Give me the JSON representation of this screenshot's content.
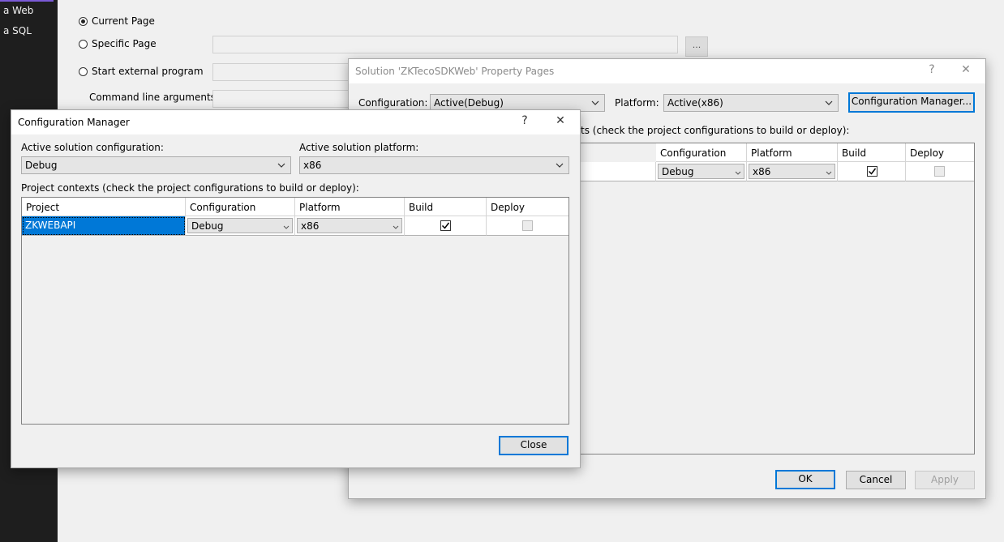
{
  "sidebar": {
    "items": [
      "a Web",
      "a SQL"
    ]
  },
  "background_page": {
    "radios": [
      {
        "label": "Current Page",
        "checked": true
      },
      {
        "label": "Specific Page",
        "checked": false
      },
      {
        "label": "Start external program",
        "checked": false
      }
    ],
    "command_line_label": "Command line arguments",
    "browse_label": "..."
  },
  "property_pages": {
    "title": "Solution 'ZKTecoSDKWeb' Property Pages",
    "help_glyph": "?",
    "close_glyph": "✕",
    "configuration_label": "Configuration:",
    "configuration_value": "Active(Debug)",
    "platform_label": "Platform:",
    "platform_value": "Active(x86)",
    "config_manager_button": "Configuration Manager...",
    "contexts_partial": "ts (check the project configurations to build or deploy):",
    "columns": [
      "Configuration",
      "Platform",
      "Build",
      "Deploy"
    ],
    "row": {
      "configuration": "Debug",
      "platform": "x86",
      "build": true,
      "deploy": false
    },
    "ok_button": "OK",
    "cancel_button": "Cancel",
    "apply_button": "Apply"
  },
  "config_manager": {
    "title": "Configuration Manager",
    "help_glyph": "?",
    "close_glyph": "✕",
    "active_config_label": "Active solution configuration:",
    "active_config_value": "Debug",
    "active_platform_label": "Active solution platform:",
    "active_platform_value": "x86",
    "contexts_label": "Project contexts (check the project configurations to build or deploy):",
    "columns": [
      "Project",
      "Configuration",
      "Platform",
      "Build",
      "Deploy"
    ],
    "row": {
      "project": "ZKWEBAPI",
      "configuration": "Debug",
      "platform": "x86",
      "build": true,
      "deploy": false
    },
    "close_button": "Close"
  },
  "colors": {
    "accent": "#0078d7",
    "sidebar": "#1e1e1e",
    "window_bg": "#f0f0f0"
  }
}
